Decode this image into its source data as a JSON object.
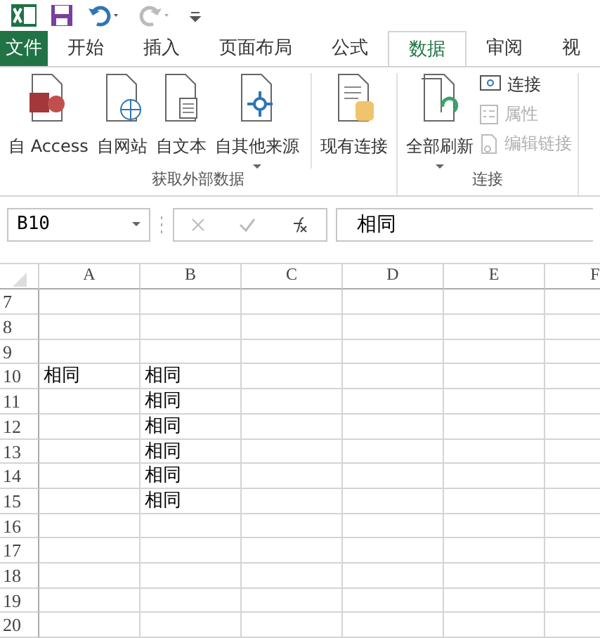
{
  "tabs": [
    {
      "label": "文件",
      "kind": "file",
      "selected": false
    },
    {
      "label": "开始",
      "kind": "tab",
      "selected": false
    },
    {
      "label": "插入",
      "kind": "tab",
      "selected": false
    },
    {
      "label": "页面布局",
      "kind": "tab",
      "selected": false
    },
    {
      "label": "公式",
      "kind": "tab",
      "selected": false
    },
    {
      "label": "数据",
      "kind": "tab",
      "selected": true
    },
    {
      "label": "审阅",
      "kind": "tab",
      "selected": false
    },
    {
      "label": "视",
      "kind": "tab",
      "selected": false
    }
  ],
  "ribbon_groups": [
    {
      "label": "获取外部数据",
      "items": [
        {
          "label": "自 Access",
          "kind": "large",
          "dropdown": false,
          "disabled": false
        },
        {
          "label": "自网站",
          "kind": "large",
          "dropdown": false,
          "disabled": false
        },
        {
          "label": "自文本",
          "kind": "large",
          "dropdown": false,
          "disabled": false
        },
        {
          "label": "自其他来源",
          "kind": "large",
          "dropdown": true,
          "disabled": false
        },
        {
          "label": "现有连接",
          "kind": "large",
          "dropdown": false,
          "disabled": false,
          "separated": true
        }
      ]
    },
    {
      "label": "连接",
      "items": [
        {
          "label": "全部刷新",
          "kind": "large",
          "dropdown": true,
          "disabled": false
        },
        {
          "label": "连接",
          "kind": "small",
          "disabled": false
        },
        {
          "label": "属性",
          "kind": "small",
          "disabled": true
        },
        {
          "label": "编辑链接",
          "kind": "small",
          "disabled": true
        }
      ]
    }
  ],
  "formula_bar": {
    "name_box": "B10",
    "formula": "相同"
  },
  "columns": [
    "A",
    "B",
    "C",
    "D",
    "E",
    "F"
  ],
  "rows": [
    {
      "header": "7"
    },
    {
      "header": "8"
    },
    {
      "header": "9"
    },
    {
      "header": "10",
      "A": "相同",
      "B": "相同"
    },
    {
      "header": "11",
      "B": "相同"
    },
    {
      "header": "12",
      "B": "相同"
    },
    {
      "header": "13",
      "B": "相同"
    },
    {
      "header": "14",
      "B": "相同"
    },
    {
      "header": "15",
      "B": "相同"
    },
    {
      "header": "16"
    },
    {
      "header": "17"
    },
    {
      "header": "18"
    },
    {
      "header": "19"
    },
    {
      "header": "20"
    }
  ]
}
